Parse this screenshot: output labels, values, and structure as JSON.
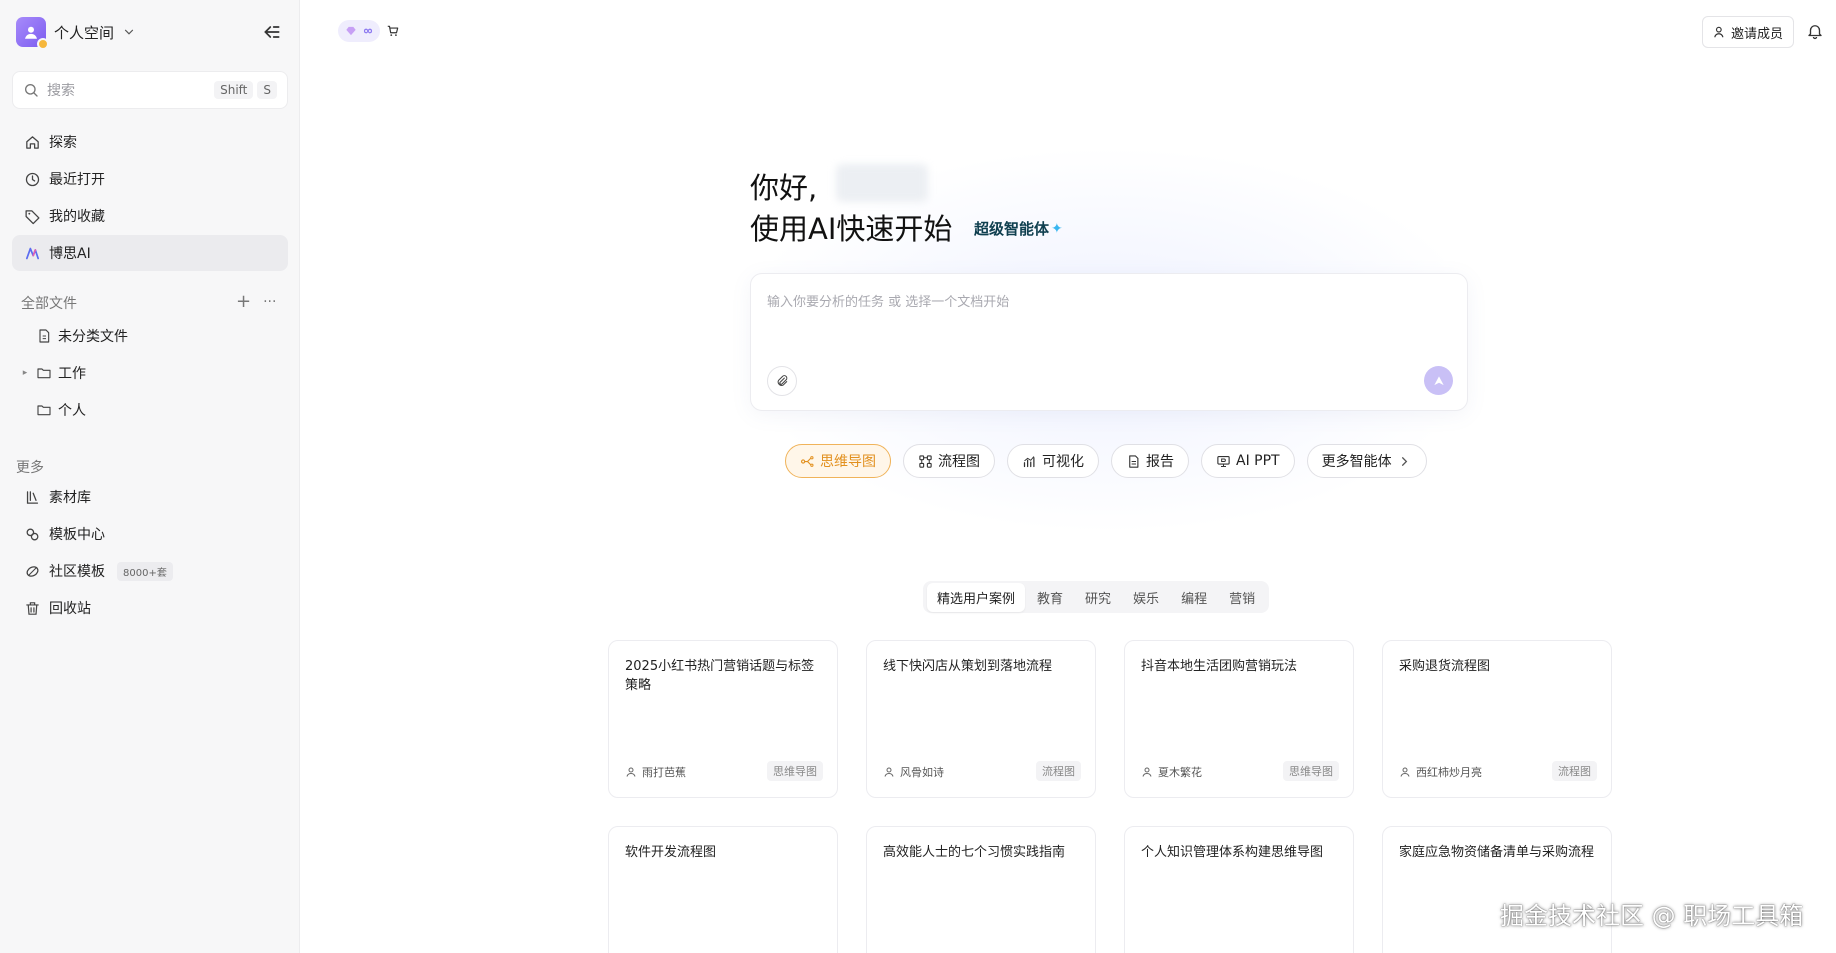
{
  "sidebar": {
    "workspace_name": "个人空间",
    "search_placeholder": "搜索",
    "search_shortcut": [
      "Shift",
      "S"
    ],
    "nav": [
      {
        "label": "探索",
        "icon": "home-icon"
      },
      {
        "label": "最近打开",
        "icon": "clock-icon"
      },
      {
        "label": "我的收藏",
        "icon": "tag-icon"
      },
      {
        "label": "博思AI",
        "icon": "boardmix-ai-icon",
        "active": true
      }
    ],
    "files_title": "全部文件",
    "files": [
      {
        "label": "未分类文件",
        "icon": "file-icon"
      },
      {
        "label": "工作",
        "icon": "folder-icon",
        "collapsible": true
      },
      {
        "label": "个人",
        "icon": "folder-icon"
      }
    ],
    "more_title": "更多",
    "more": [
      {
        "label": "素材库",
        "icon": "library-icon"
      },
      {
        "label": "模板中心",
        "icon": "template-icon"
      },
      {
        "label": "社区模板",
        "icon": "community-icon",
        "badge": "8000+套"
      },
      {
        "label": "回收站",
        "icon": "trash-icon"
      }
    ]
  },
  "topbar": {
    "invite_label": "邀请成员"
  },
  "hero": {
    "greeting": "你好,",
    "subtitle": "使用AI快速开始",
    "agent_tag": "超级智能体",
    "input_placeholder": "输入你要分析的任务 或 选择一个文档开始",
    "chips": [
      {
        "label": "思维导图",
        "icon": "mindmap-icon",
        "active": true
      },
      {
        "label": "流程图",
        "icon": "flowchart-icon"
      },
      {
        "label": "可视化",
        "icon": "chart-icon"
      },
      {
        "label": "报告",
        "icon": "report-icon"
      },
      {
        "label": "AI PPT",
        "icon": "ppt-icon"
      },
      {
        "label": "更多智能体",
        "icon": "chevron-right-icon"
      }
    ]
  },
  "categories": [
    "精选用户案例",
    "教育",
    "研究",
    "娱乐",
    "编程",
    "营销"
  ],
  "cards": [
    {
      "title": "2025小红书热门营销话题与标签策略",
      "author": "雨打芭蕉",
      "type": "思维导图"
    },
    {
      "title": "线下快闪店从策划到落地流程",
      "author": "风骨如诗",
      "type": "流程图"
    },
    {
      "title": "抖音本地生活团购营销玩法",
      "author": "夏木繁花",
      "type": "思维导图"
    },
    {
      "title": "采购退货流程图",
      "author": "西红柿炒月亮",
      "type": "流程图"
    },
    {
      "title": "软件开发流程图",
      "author": "",
      "type": ""
    },
    {
      "title": "高效能人士的七个习惯实践指南",
      "author": "",
      "type": ""
    },
    {
      "title": "个人知识管理体系构建思维导图",
      "author": "",
      "type": ""
    },
    {
      "title": "家庭应急物资储备清单与采购流程",
      "author": "",
      "type": ""
    }
  ],
  "watermark": "掘金技术社区 @ 职场工具箱",
  "colors": {
    "accent": "#7c5cf0",
    "chip_active": "#e2901e",
    "sidebar_bg": "#f7f7f8"
  }
}
